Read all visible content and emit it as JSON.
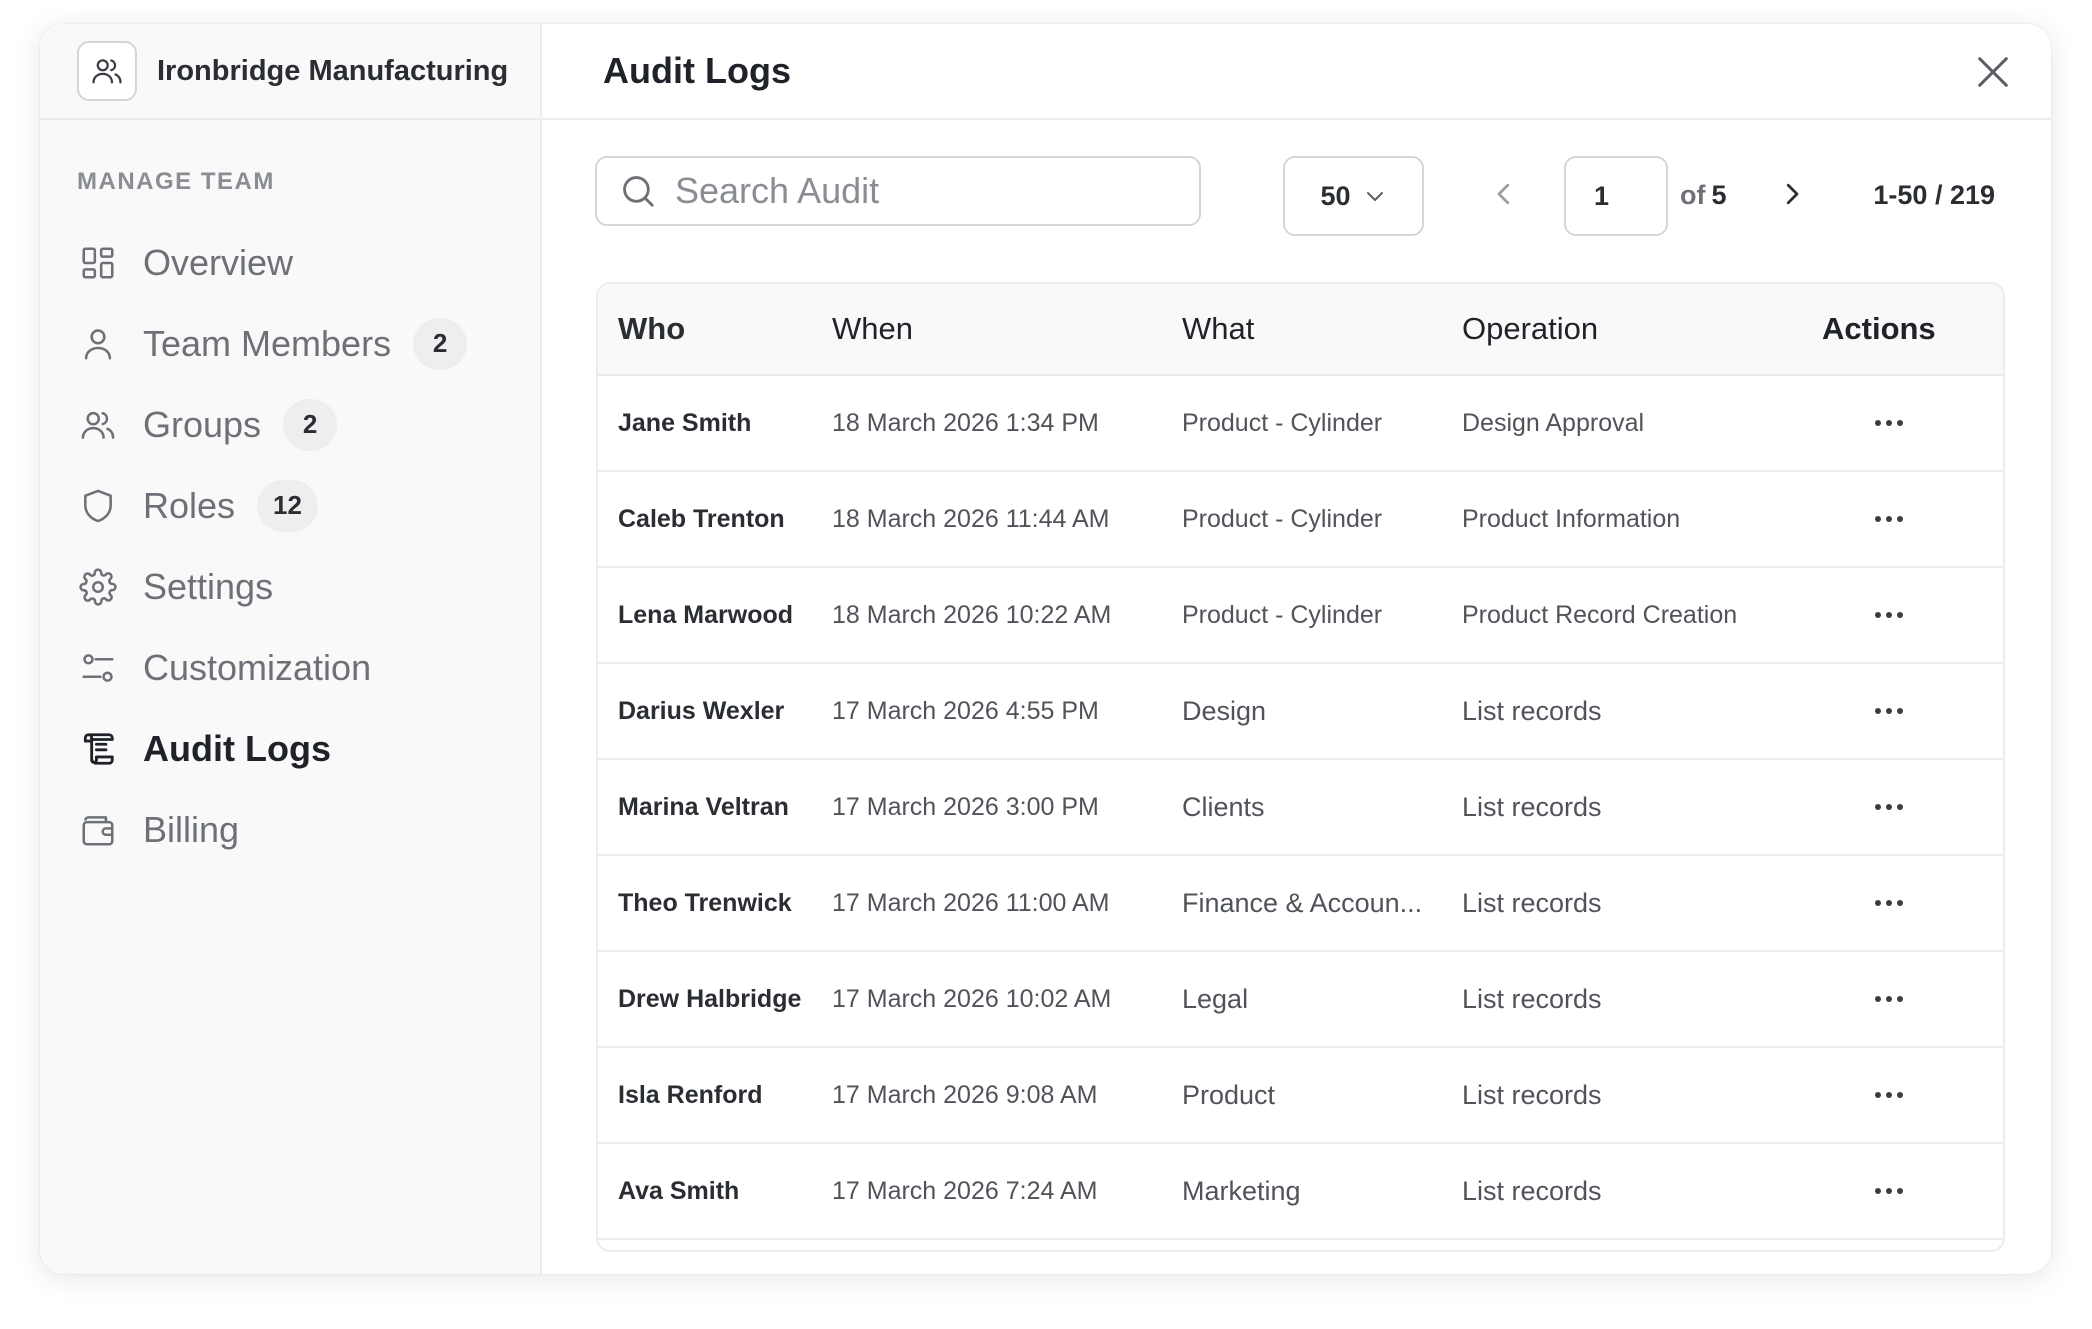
{
  "org": {
    "name": "Ironbridge Manufacturing"
  },
  "sidebar": {
    "section_label": "MANAGE TEAM",
    "items": [
      {
        "label": "Overview",
        "icon": "grid-icon",
        "badge": null
      },
      {
        "label": "Team Members",
        "icon": "user-icon",
        "badge": "2"
      },
      {
        "label": "Groups",
        "icon": "users-icon",
        "badge": "2"
      },
      {
        "label": "Roles",
        "icon": "shield-icon",
        "badge": "12"
      },
      {
        "label": "Settings",
        "icon": "gear-icon",
        "badge": null
      },
      {
        "label": "Customization",
        "icon": "sliders-icon",
        "badge": null
      },
      {
        "label": "Audit Logs",
        "icon": "scroll-icon",
        "badge": null,
        "active": true
      },
      {
        "label": "Billing",
        "icon": "wallet-icon",
        "badge": null
      }
    ]
  },
  "main": {
    "title": "Audit Logs",
    "search": {
      "placeholder": "Search Audit",
      "value": ""
    },
    "page_size": "50",
    "pagination": {
      "current": "1",
      "of_label": "of",
      "total_pages": "5",
      "range": "1-50 / 219"
    }
  },
  "table": {
    "columns": [
      "Who",
      "When",
      "What",
      "Operation",
      "Actions"
    ],
    "rows": [
      {
        "who": "Jane Smith",
        "when": "18 March 2026 1:34 PM",
        "what": "Product - Cylinder",
        "operation": "Design Approval"
      },
      {
        "who": "Caleb Trenton",
        "when": "18 March 2026 11:44 AM",
        "what": "Product - Cylinder",
        "operation": "Product Information"
      },
      {
        "who": "Lena Marwood",
        "when": "18 March 2026 10:22 AM",
        "what": "Product - Cylinder",
        "operation": "Product Record Creation"
      },
      {
        "who": "Darius Wexler",
        "when": "17 March 2026 4:55 PM",
        "what": "Design",
        "operation": "List records"
      },
      {
        "who": "Marina Veltran",
        "when": "17 March 2026 3:00 PM",
        "what": "Clients",
        "operation": "List records"
      },
      {
        "who": "Theo Trenwick",
        "when": "17 March 2026 11:00 AM",
        "what": "Finance & Accoun...",
        "operation": "List records"
      },
      {
        "who": "Drew Halbridge",
        "when": "17 March 2026 10:02 AM",
        "what": "Legal",
        "operation": "List records"
      },
      {
        "who": "Isla Renford",
        "when": "17 March 2026 9:08 AM",
        "what": "Product",
        "operation": "List records"
      },
      {
        "who": "Ava Smith",
        "when": "17 March 2026 7:24 AM",
        "what": "Marketing",
        "operation": "List records"
      }
    ]
  }
}
